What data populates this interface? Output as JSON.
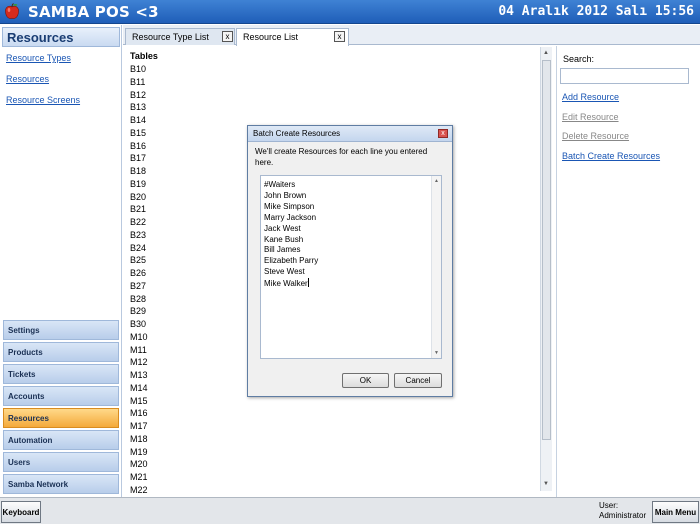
{
  "app": {
    "title": "SAMBA POS <3",
    "clock": "04 Aralık 2012 Salı 15:56"
  },
  "sidebar": {
    "title": "Resources",
    "links": [
      "Resource Types",
      "Resources",
      "Resource Screens"
    ],
    "nav": [
      "Settings",
      "Products",
      "Tickets",
      "Accounts",
      "Resources",
      "Automation",
      "Users",
      "Samba Network"
    ],
    "active_nav": "Resources"
  },
  "tabs": [
    {
      "label": "Resource Type List",
      "close": "x",
      "active": false
    },
    {
      "label": "Resource List",
      "close": "x",
      "active": true
    }
  ],
  "list": {
    "header": "Tables",
    "items": [
      "B10",
      "B11",
      "B12",
      "B13",
      "B14",
      "B15",
      "B16",
      "B17",
      "B18",
      "B19",
      "B20",
      "B21",
      "B22",
      "B23",
      "B24",
      "B25",
      "B26",
      "B27",
      "B28",
      "B29",
      "B30",
      "M10",
      "M11",
      "M12",
      "M13",
      "M14",
      "M15",
      "M16",
      "M17",
      "M18",
      "M19",
      "M20",
      "M21",
      "M22"
    ]
  },
  "right_panel": {
    "search_label": "Search:",
    "search_value": "",
    "actions": [
      {
        "label": "Add Resource",
        "enabled": true
      },
      {
        "label": "Edit Resource",
        "enabled": false
      },
      {
        "label": "Delete Resource",
        "enabled": false
      },
      {
        "label": "Batch Create Resources",
        "enabled": true
      }
    ]
  },
  "dialog": {
    "title": "Batch Create Resources",
    "close": "x",
    "message": "We'll create Resources for each line you entered here.",
    "lines": [
      "#Waiters",
      "John Brown",
      "Mike Simpson",
      "Marry Jackson",
      "Jack West",
      "Kane Bush",
      "Bill James",
      "Elizabeth Parry",
      "Steve West",
      "Mike Walker"
    ],
    "ok_label": "OK",
    "cancel_label": "Cancel"
  },
  "bottom": {
    "keyboard_label": "Keyboard",
    "user_label": "User:",
    "user_name": "Administrator",
    "main_menu_label": "Main Menu"
  }
}
